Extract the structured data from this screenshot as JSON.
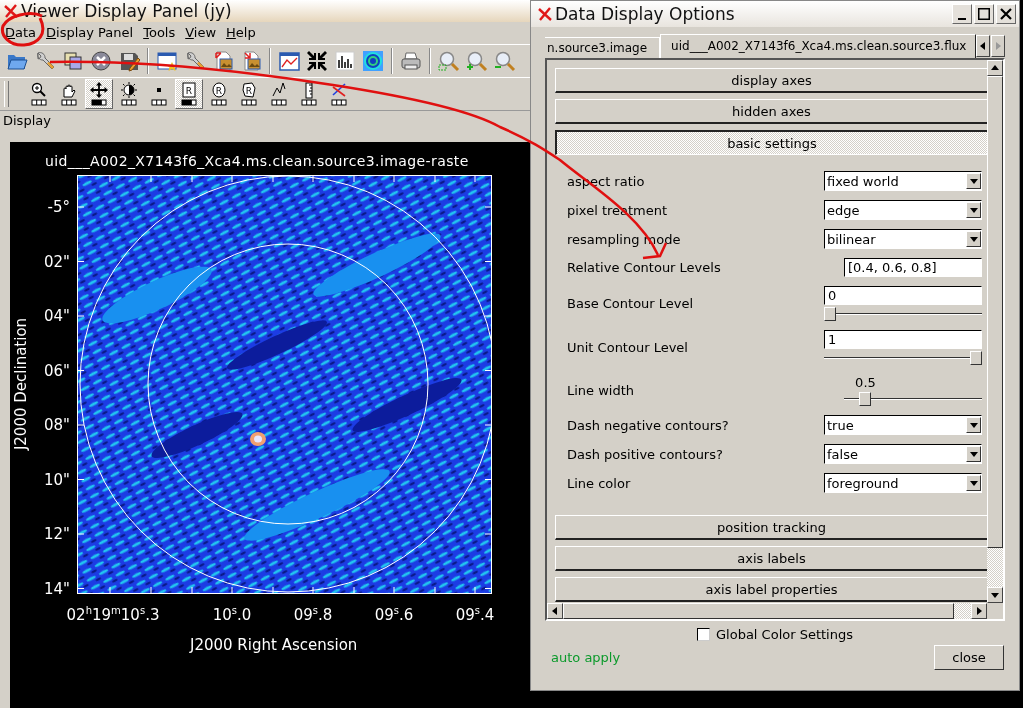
{
  "viewer_window": {
    "title": "Viewer Display Panel (jy)",
    "menu": [
      "Data",
      "Display Panel",
      "Tools",
      "View",
      "Help"
    ],
    "mouse_tools": [
      {
        "selected": false
      },
      {
        "selected": false
      },
      {
        "selected": true
      },
      {
        "selected": false
      },
      {
        "selected": false
      },
      {
        "label": "R",
        "selected": true
      },
      {
        "label": "R",
        "selected": false
      },
      {
        "label": "R",
        "selected": false
      },
      {
        "selected": false
      },
      {
        "selected": false
      },
      {
        "selected": false
      }
    ],
    "panel_label": "Display",
    "plot": {
      "title": "uid___A002_X7143f6_Xca4.ms.clean.source3.image-raste",
      "y_tick_labels": [
        "-5°",
        "02\"",
        "04\"",
        "06\"",
        "08\"",
        "10\"",
        "12\"",
        "14\""
      ],
      "x_tick_labels": [
        "02$^{h}$19$^{m}$10$^{s}$.3",
        "10$^{s}$.0",
        "09$^{s}$.8",
        "09$^{s}$.6",
        "09$^{s}$.4"
      ],
      "xlabel": "J2000 Right Ascension",
      "ylabel": "J2000 Declination"
    }
  },
  "options_dialog": {
    "title": "Data Display Options",
    "tabs": [
      {
        "label": "n.source3.image",
        "selected": false
      },
      {
        "label": "uid___A002_X7143f6_Xca4.ms.clean.source3.flux",
        "selected": true
      }
    ],
    "sections": [
      {
        "label": "display axes",
        "expanded": false
      },
      {
        "label": "hidden axes",
        "expanded": false
      },
      {
        "label": "basic settings",
        "expanded": true,
        "settings": [
          {
            "kind": "dropdown",
            "label": "aspect ratio",
            "value": "fixed world"
          },
          {
            "kind": "dropdown",
            "label": "pixel treatment",
            "value": "edge"
          },
          {
            "kind": "dropdown",
            "label": "resampling mode",
            "value": "bilinear"
          },
          {
            "kind": "text",
            "label": "Relative Contour Levels",
            "value": "[0.4, 0.6, 0.8]"
          },
          {
            "kind": "text_slider",
            "label": "Base Contour Level",
            "value": "0",
            "level": 0
          },
          {
            "kind": "text_slider",
            "label": "Unit Contour Level",
            "value": "1",
            "level": 1
          },
          {
            "kind": "slider",
            "label": "Line width",
            "reading": "0.5",
            "level": 0.12
          },
          {
            "kind": "dropdown",
            "label": "Dash negative contours?",
            "value": "true"
          },
          {
            "kind": "dropdown",
            "label": "Dash positive contours?",
            "value": "false"
          },
          {
            "kind": "dropdown",
            "label": "Line color",
            "value": "foreground"
          }
        ]
      },
      {
        "label": "position tracking",
        "expanded": false
      },
      {
        "label": "axis labels",
        "expanded": false
      },
      {
        "label": "axis label properties",
        "expanded": false
      }
    ],
    "global_color_settings": {
      "label": "Global Color Settings",
      "checked": false
    },
    "auto_apply": "auto apply",
    "close_button": "close"
  }
}
